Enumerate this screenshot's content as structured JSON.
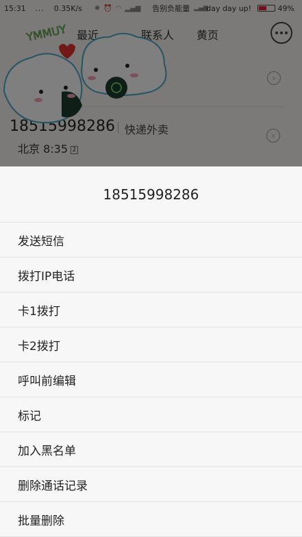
{
  "status_bar": {
    "time": "15:31",
    "dots": "...",
    "speed": "0.35K/s",
    "carrier1": "告别负能量",
    "carrier2": "day day up!",
    "battery": "49%"
  },
  "tabs": {
    "recent": "最近",
    "contacts": "联系人",
    "yellow_pages": "黄页"
  },
  "background_call_log": {
    "row2": {
      "number": "18515998286",
      "tag": "快递外卖",
      "location_time": "北京 8:35",
      "sim": "2"
    }
  },
  "sticker_text": "YMMUY",
  "action_sheet": {
    "title": "18515998286",
    "items": [
      "发送短信",
      "拨打IP电话",
      "卡1拨打",
      "卡2拨打",
      "呼叫前编辑",
      "标记",
      "加入黑名单",
      "删除通话记录",
      "批量删除"
    ]
  }
}
